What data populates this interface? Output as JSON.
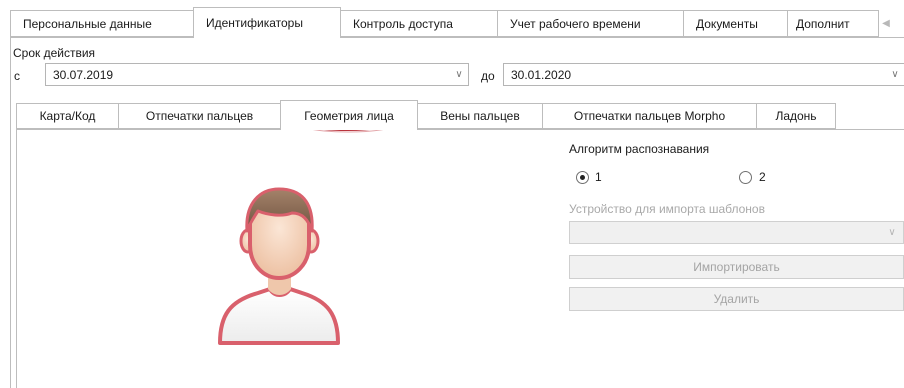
{
  "top_tabs": [
    {
      "label": "Персональные данные",
      "active": false
    },
    {
      "label": "Идентификаторы",
      "active": true
    },
    {
      "label": "Контроль доступа",
      "active": false
    },
    {
      "label": "Учет рабочего времени",
      "active": false
    },
    {
      "label": "Документы",
      "active": false
    },
    {
      "label": "Дополнит",
      "active": false
    }
  ],
  "validity": {
    "title": "Срок действия",
    "from_label": "с",
    "from_value": "30.07.2019",
    "to_label": "до",
    "to_value": "30.01.2020"
  },
  "inner_tabs": [
    {
      "label": "Карта/Код",
      "active": false
    },
    {
      "label": "Отпечатки пальцев",
      "active": false
    },
    {
      "label": "Геометрия лица",
      "active": true
    },
    {
      "label": "Вены пальцев",
      "active": false
    },
    {
      "label": "Отпечатки пальцев Morpho",
      "active": false
    },
    {
      "label": "Ладонь",
      "active": false
    }
  ],
  "algorithm": {
    "label": "Алгоритм распознавания",
    "options": [
      {
        "label": "1",
        "selected": true
      },
      {
        "label": "2",
        "selected": false
      }
    ]
  },
  "import_device": {
    "label": "Устройство для импорта шаблонов",
    "value": ""
  },
  "buttons": {
    "import": "Импортировать",
    "delete": "Удалить"
  },
  "colors": {
    "highlight": "#c0303a",
    "avatar_outline": "#d9606c",
    "skin": "#f6d8c2",
    "hair": "#8a6a50"
  }
}
